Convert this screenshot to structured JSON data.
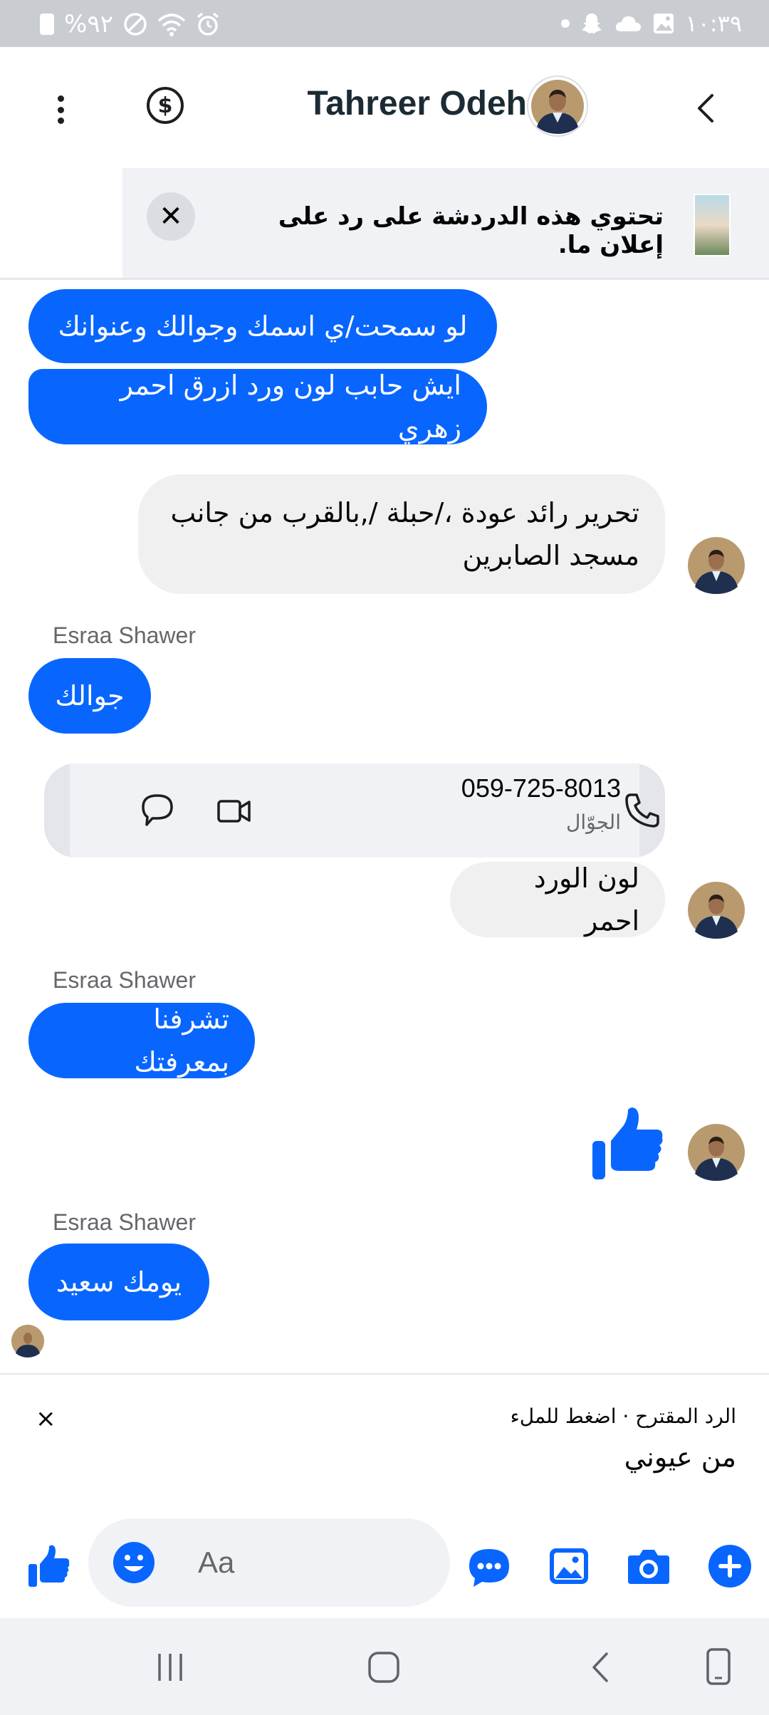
{
  "status_bar": {
    "battery_text": "%٩٢",
    "time": "١٠:٣٩"
  },
  "header": {
    "contact_name": "Tahreer Odeh"
  },
  "banner": {
    "text": "تحتوي هذه الدردشة على رد على إعلان ما.",
    "close_label": "✕"
  },
  "messages": {
    "m1": "لو سمحت/ي اسمك وجوالك وعنوانك",
    "m2": "ايش حابب لون ورد ازرق احمر زهري",
    "m3_line1": "تحرير رائد عودة ،/حبلة /,بالقرب من جانب",
    "m3_line2": "مسجد الصابرين",
    "sender_1": "Esraa Shawer",
    "m4": "جوالك",
    "contact_card": {
      "number": "059-725-8013",
      "label": "الجوّال"
    },
    "m5": "لون الورد احمر",
    "sender_2": "Esraa Shawer",
    "m6": "تشرفنا بمعرفتك",
    "sender_3": "Esraa Shawer",
    "m7": "يومك سعيد"
  },
  "suggested_reply": {
    "caption": "الرد المقترح · اضغط للملء",
    "text": "من عيوني",
    "close_label": "×"
  },
  "composer": {
    "placeholder": "Aa"
  },
  "colors": {
    "messenger_blue": "#0866ff",
    "bubble_gray": "#f0f0f0",
    "status_bar": "#c9ccd1"
  }
}
